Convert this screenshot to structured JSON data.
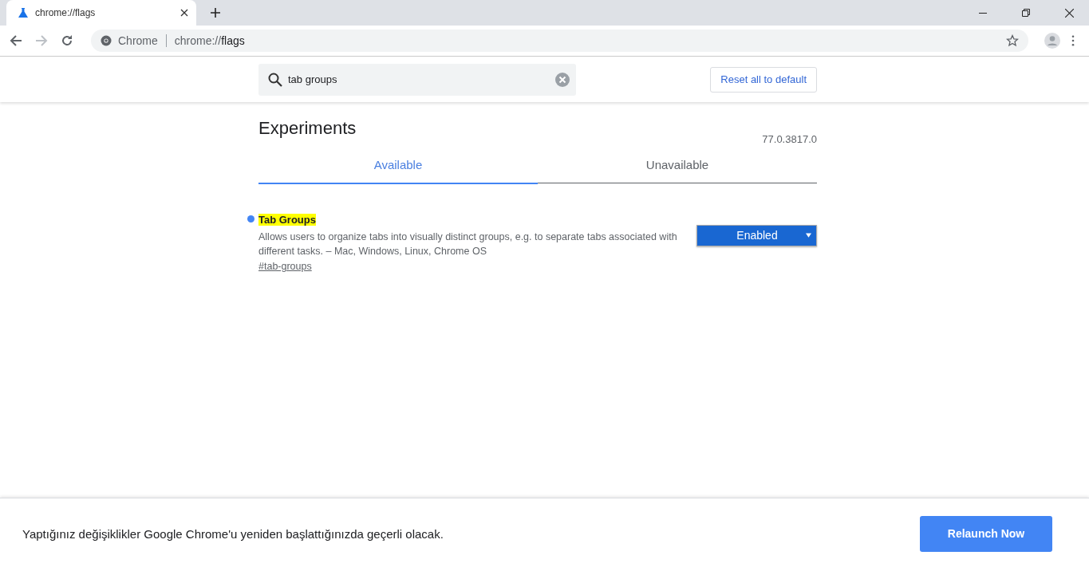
{
  "browser_tab": {
    "title": "chrome://flags"
  },
  "toolbar": {
    "site_label": "Chrome",
    "url_scheme": "chrome://",
    "url_path": "flags"
  },
  "search": {
    "value": "tab groups"
  },
  "reset_button": "Reset all to default",
  "heading": "Experiments",
  "version": "77.0.3817.0",
  "tabs": [
    {
      "label": "Available",
      "selected": true
    },
    {
      "label": "Unavailable",
      "selected": false
    }
  ],
  "flags": [
    {
      "title": "Tab Groups",
      "highlighted": true,
      "modified": true,
      "description": "Allows users to organize tabs into visually distinct groups, e.g. to separate tabs associated with different tasks. – Mac, Windows, Linux, Chrome OS",
      "link": "#tab-groups",
      "value": "Enabled",
      "enabled": true
    }
  ],
  "relaunch": {
    "message": "Yaptığınız değişiklikler Google Chrome'u yeniden başlattığınızda geçerli olacak.",
    "button": "Relaunch Now"
  }
}
